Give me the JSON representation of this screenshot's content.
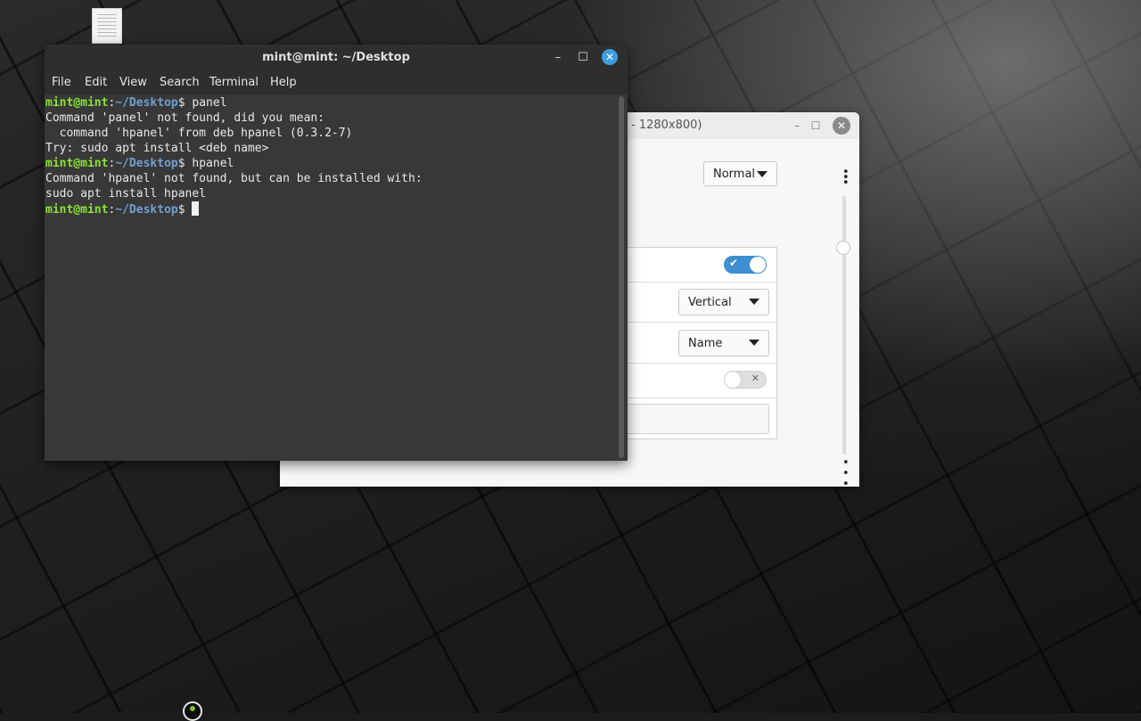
{
  "terminal": {
    "title": "mint@mint: ~/Desktop",
    "menu": [
      "File",
      "Edit",
      "View",
      "Search",
      "Terminal",
      "Help"
    ],
    "prompt_user": "mint@mint",
    "prompt_sep": ":",
    "prompt_path": "~/Desktop",
    "prompt_end": "$",
    "commands": [
      "panel",
      "hpanel",
      ""
    ],
    "output": [
      "Command 'panel' not found, did you mean:",
      "  command 'hpanel' from deb hpanel (0.3.2-7)",
      "Try: sudo apt install <deb name>",
      "Command 'hpanel' not found, but can be installed with:",
      "sudo apt install hpanel"
    ],
    "icons": {
      "minimize": "minimize-icon",
      "maximize": "maximize-icon",
      "close": "close-icon"
    }
  },
  "settings_window": {
    "title": "- 1280x800)",
    "mode_dropdown": "Normal",
    "orientation_dropdown": "Vertical",
    "sort_dropdown": "Name",
    "toggle_1_on": true,
    "toggle_2_on": false
  },
  "colors": {
    "prompt_user": "#8ae234",
    "prompt_path": "#729fcf",
    "toggle_on": "#3d8fd1",
    "close_button": "#3d9ee0"
  }
}
